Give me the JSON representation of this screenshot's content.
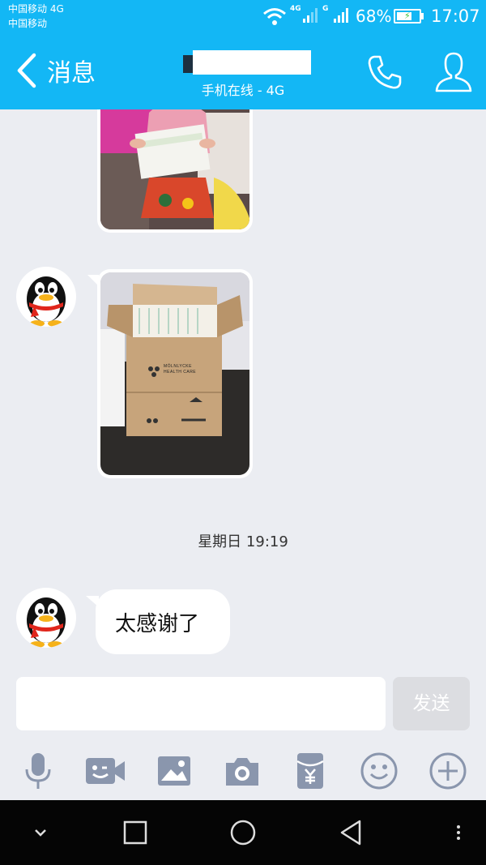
{
  "status": {
    "carrier_line1": "中国移动 4G",
    "carrier_line2": "中国移动",
    "net1": "4G",
    "net2": "G",
    "battery": "68%",
    "battery_level": 0.68,
    "time": "17:07"
  },
  "header": {
    "back_label": "消息",
    "subtitle": "手机在线 - 4G"
  },
  "icons": {
    "back": "chevron-left-icon",
    "call": "phone-icon",
    "profile": "profile-icon",
    "tools": [
      "microphone-icon",
      "video-call-icon",
      "image-icon",
      "camera-icon",
      "red-packet-icon",
      "emoji-icon",
      "plus-icon"
    ]
  },
  "chat": {
    "photo_box_label_1": "MÖLNLYCKE",
    "photo_box_label_2": "HEALTH CARE",
    "timestamp": "星期日 19:19",
    "message": "太感谢了"
  },
  "composer": {
    "send_label": "发送"
  },
  "colors": {
    "accent": "#13b7f5",
    "chat_bg": "#ebedf2",
    "send_disabled": "#dcdde1"
  }
}
